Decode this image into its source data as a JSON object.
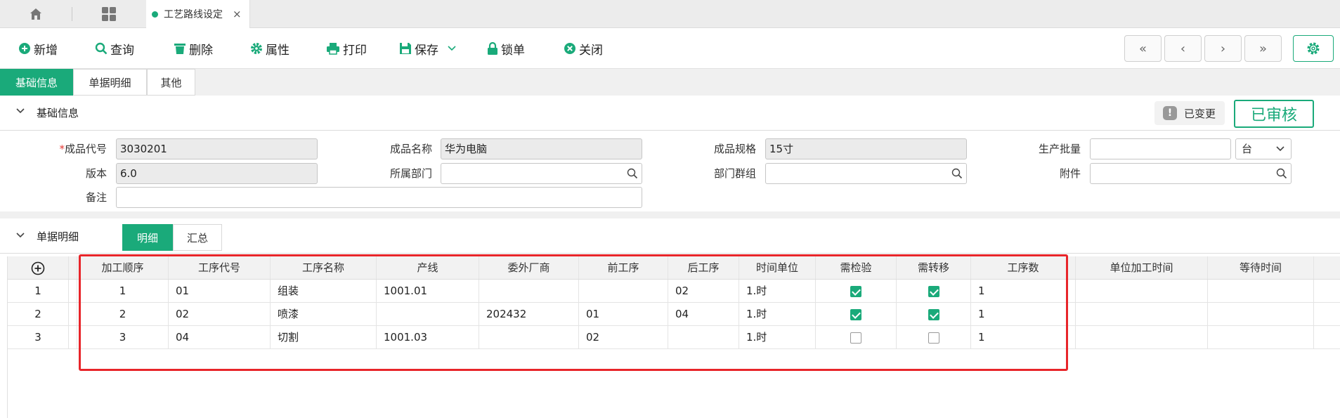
{
  "tabbar": {
    "active_tab": "工艺路线设定",
    "close_glyph": "×"
  },
  "toolbar": {
    "new": "新增",
    "query": "查询",
    "delete": "删除",
    "properties": "属性",
    "print": "打印",
    "save": "保存",
    "lock": "锁单",
    "close": "关闭",
    "nav": [
      "«",
      "‹",
      "›",
      "»"
    ]
  },
  "subtabs": [
    "基础信息",
    "单据明细",
    "其他"
  ],
  "basic_info": {
    "title": "基础信息",
    "changed_badge": "已变更",
    "approved_stamp": "已审核",
    "fields": {
      "product_code": {
        "label": "成品代号",
        "required_mark": "*",
        "value": "3030201"
      },
      "product_name": {
        "label": "成品名称",
        "value": "华为电脑"
      },
      "product_spec": {
        "label": "成品规格",
        "value": "15寸"
      },
      "batch_qty": {
        "label": "生产批量",
        "value": "",
        "unit": "台"
      },
      "version": {
        "label": "版本",
        "value": "6.0"
      },
      "department": {
        "label": "所属部门",
        "value": ""
      },
      "dept_group": {
        "label": "部门群组",
        "value": ""
      },
      "attachment": {
        "label": "附件",
        "value": ""
      },
      "remark": {
        "label": "备注",
        "value": ""
      }
    }
  },
  "detail": {
    "title": "单据明细",
    "segments": [
      "明细",
      "汇总"
    ],
    "columns": [
      "加工顺序",
      "工序代号",
      "工序名称",
      "产线",
      "委外厂商",
      "前工序",
      "后工序",
      "时间单位",
      "需检验",
      "需转移",
      "工序数",
      "单位加工时间",
      "等待时间"
    ],
    "rows": [
      {
        "no": "1",
        "seq": "1",
        "code": "01",
        "name": "组装",
        "line": "1001.01",
        "vendor": "",
        "prev": "",
        "next": "02",
        "unit": "1.时",
        "inspect": true,
        "transfer": true,
        "count": "1",
        "unit_time": "",
        "wait": ""
      },
      {
        "no": "2",
        "seq": "2",
        "code": "02",
        "name": "喷漆",
        "line": "",
        "vendor": "202432",
        "prev": "01",
        "next": "04",
        "unit": "1.时",
        "inspect": true,
        "transfer": true,
        "count": "1",
        "unit_time": "",
        "wait": ""
      },
      {
        "no": "3",
        "seq": "3",
        "code": "04",
        "name": "切割",
        "line": "1001.03",
        "vendor": "",
        "prev": "02",
        "next": "",
        "unit": "1.时",
        "inspect": false,
        "transfer": false,
        "count": "1",
        "unit_time": "",
        "wait": ""
      }
    ]
  },
  "colors": {
    "accent": "#1aaa7a",
    "highlight": "#e8252a"
  }
}
